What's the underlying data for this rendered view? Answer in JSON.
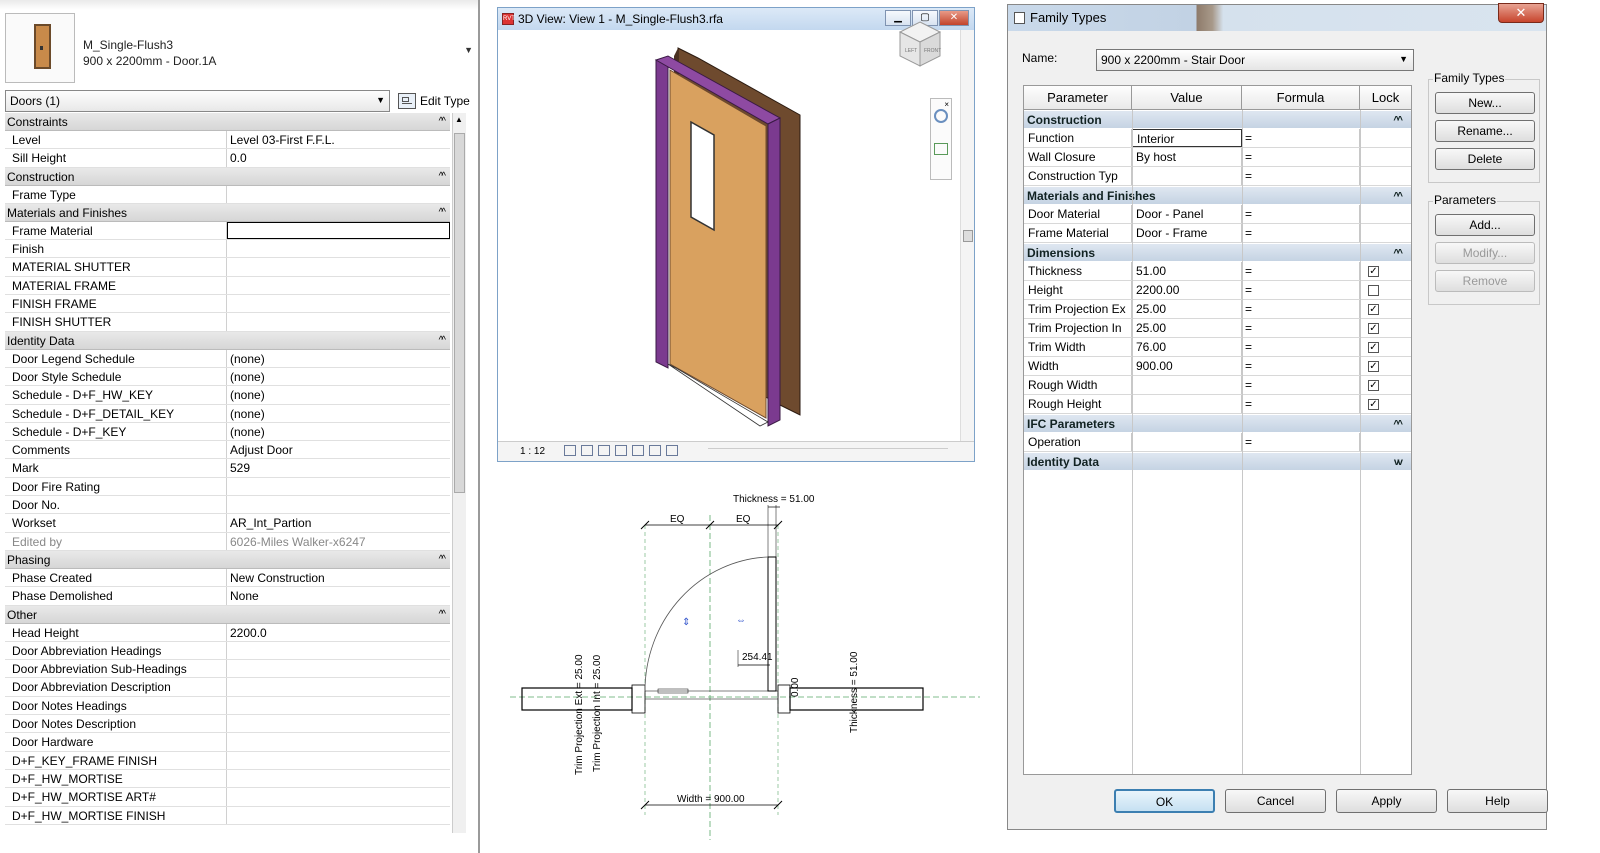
{
  "properties": {
    "type_name_line1": "M_Single-Flush3",
    "type_name_line2": "900 x 2200mm - Door.1A",
    "filter_label": "Doors (1)",
    "edit_type_label": "Edit Type",
    "groups": [
      {
        "name": "Constraints",
        "rows": [
          [
            "Level",
            "Level 03-First F.F.L."
          ],
          [
            "Sill Height",
            "0.0"
          ]
        ]
      },
      {
        "name": "Construction",
        "rows": [
          [
            "Frame Type",
            ""
          ]
        ]
      },
      {
        "name": "Materials and Finishes",
        "rows": [
          [
            "Frame Material",
            ""
          ],
          [
            "Finish",
            ""
          ],
          [
            "MATERIAL SHUTTER",
            ""
          ],
          [
            "MATERIAL FRAME",
            ""
          ],
          [
            "FINISH FRAME",
            ""
          ],
          [
            "FINISH SHUTTER",
            ""
          ]
        ]
      },
      {
        "name": "Identity Data",
        "rows": [
          [
            "Door Legend Schedule",
            "(none)"
          ],
          [
            "Door Style Schedule",
            "(none)"
          ],
          [
            "Schedule - D+F_HW_KEY",
            "(none)"
          ],
          [
            "Schedule - D+F_DETAIL_KEY",
            "(none)"
          ],
          [
            "Schedule - D+F_KEY",
            "(none)"
          ],
          [
            "Comments",
            "Adjust Door"
          ],
          [
            "Mark",
            "529"
          ],
          [
            "Door Fire Rating",
            ""
          ],
          [
            "Door No.",
            ""
          ],
          [
            "Workset",
            "AR_Int_Partion"
          ],
          [
            "Edited by",
            "6026-Miles Walker-x6247"
          ]
        ]
      },
      {
        "name": "Phasing",
        "rows": [
          [
            "Phase Created",
            "New Construction"
          ],
          [
            "Phase Demolished",
            "None"
          ]
        ]
      },
      {
        "name": "Other",
        "rows": [
          [
            "Head Height",
            "2200.0"
          ],
          [
            "Door Abbreviation Headings",
            ""
          ],
          [
            "Door Abbreviation Sub-Headings",
            ""
          ],
          [
            "Door Abbreviation Description",
            ""
          ],
          [
            "Door Notes Headings",
            ""
          ],
          [
            "Door Notes Description",
            ""
          ],
          [
            "Door Hardware",
            ""
          ],
          [
            "D+F_KEY_FRAME FINISH",
            ""
          ],
          [
            "D+F_HW_MORTISE",
            ""
          ],
          [
            "D+F_HW_MORTISE ART#",
            ""
          ],
          [
            "D+F_HW_MORTISE FINISH",
            ""
          ]
        ]
      }
    ]
  },
  "view3d": {
    "title": "3D View: View 1 - M_Single-Flush3.rfa",
    "scale": "1 : 12",
    "viewcube_left": "LEFT",
    "viewcube_front": "FRONT"
  },
  "plan": {
    "thickness_top": "Thickness = 51.00",
    "eq": "EQ",
    "dim_254": "254.41",
    "dim_000": "0.00",
    "trim_ext": "Trim Projection Ext = 25.00",
    "trim_int": "Trim Projection Int = 25.00",
    "thickness_right": "Thickness = 51.00",
    "width": "Width = 900.00"
  },
  "family_types": {
    "title": "Family Types",
    "name_label": "Name:",
    "name_value": "900 x 2200mm - Stair Door",
    "columns": [
      "Parameter",
      "Value",
      "Formula",
      "Lock"
    ],
    "groups": [
      {
        "name": "Construction",
        "collapsed": false,
        "rows": [
          {
            "p": "Function",
            "v": "Interior",
            "f": "=",
            "lock": null
          },
          {
            "p": "Wall Closure",
            "v": "By host",
            "f": "=",
            "lock": null
          },
          {
            "p": "Construction Typ",
            "v": "",
            "f": "=",
            "lock": null
          }
        ]
      },
      {
        "name": "Materials and Finishes",
        "collapsed": false,
        "rows": [
          {
            "p": "Door Material",
            "v": "Door - Panel",
            "f": "=",
            "lock": null
          },
          {
            "p": "Frame Material",
            "v": "Door - Frame",
            "f": "=",
            "lock": null
          }
        ]
      },
      {
        "name": "Dimensions",
        "collapsed": false,
        "rows": [
          {
            "p": "Thickness",
            "v": "51.00",
            "f": "=",
            "lock": true
          },
          {
            "p": "Height",
            "v": "2200.00",
            "f": "=",
            "lock": false
          },
          {
            "p": "Trim Projection Ex",
            "v": "25.00",
            "f": "=",
            "lock": true
          },
          {
            "p": "Trim Projection In",
            "v": "25.00",
            "f": "=",
            "lock": true
          },
          {
            "p": "Trim Width",
            "v": "76.00",
            "f": "=",
            "lock": true
          },
          {
            "p": "Width",
            "v": "900.00",
            "f": "=",
            "lock": true
          },
          {
            "p": "Rough Width",
            "v": "",
            "f": "=",
            "lock": true
          },
          {
            "p": "Rough Height",
            "v": "",
            "f": "=",
            "lock": true
          }
        ]
      },
      {
        "name": "IFC Parameters",
        "collapsed": false,
        "rows": [
          {
            "p": "Operation",
            "v": "",
            "f": "=",
            "lock": null
          }
        ]
      },
      {
        "name": "Identity Data",
        "collapsed": true,
        "rows": []
      }
    ],
    "family_types_group": "Family Types",
    "btn_new": "New...",
    "btn_rename": "Rename...",
    "btn_delete": "Delete",
    "parameters_group": "Parameters",
    "btn_add": "Add...",
    "btn_modify": "Modify...",
    "btn_remove": "Remove",
    "btn_ok": "OK",
    "btn_cancel": "Cancel",
    "btn_apply": "Apply",
    "btn_help": "Help"
  },
  "colors": {
    "door_leaf": "#d9a15f",
    "door_frame": "#6e4a2e",
    "trim": "#7b3a8f",
    "group_header": "#c5d3e3"
  }
}
